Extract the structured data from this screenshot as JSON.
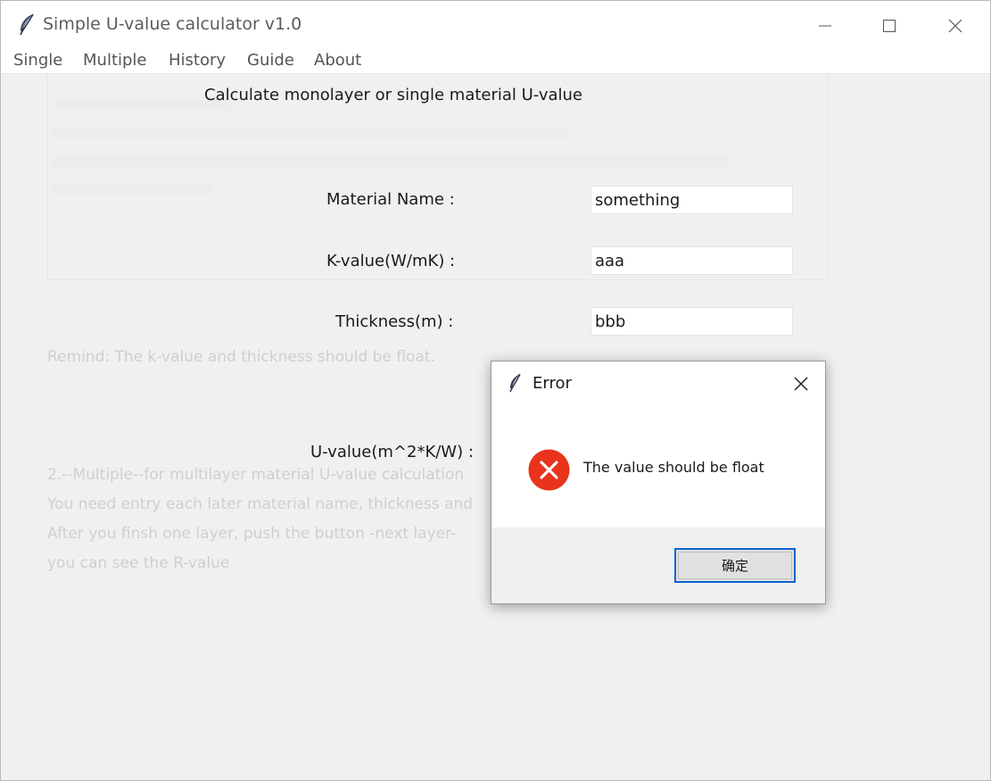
{
  "window": {
    "title": "Simple U-value calculator v1.0"
  },
  "menu": [
    "Single",
    "Multiple",
    "History",
    "Guide",
    "About"
  ],
  "single": {
    "heading": "Calculate monolayer or single material U-value",
    "material_label": "Material Name :",
    "material_value": "something",
    "k_label": "K-value(W/mK) :",
    "k_value": "aaa",
    "thickness_label": "Thickness(m) :",
    "thickness_value": "bbb",
    "u_label": "U-value(m^2*K/W) :"
  },
  "guide_background": {
    "remind": "Remind: The k-value and thickness should be float.",
    "multiple_line1": "2.--Multiple--for multilayer material U-value calculation",
    "multiple_line2": "You need entry each later material name, thickness and",
    "multiple_line3": "After you finsh one layer, push the button -next layer-",
    "multiple_line4": "you can see the R-value"
  },
  "dialog": {
    "title": "Error",
    "message": "The value should be float",
    "ok_label": "确定",
    "icon": "error-icon",
    "icon_color": "#e8341c"
  },
  "colors": {
    "accent": "#0a64d0",
    "window_bg": "#f0f0f0"
  }
}
